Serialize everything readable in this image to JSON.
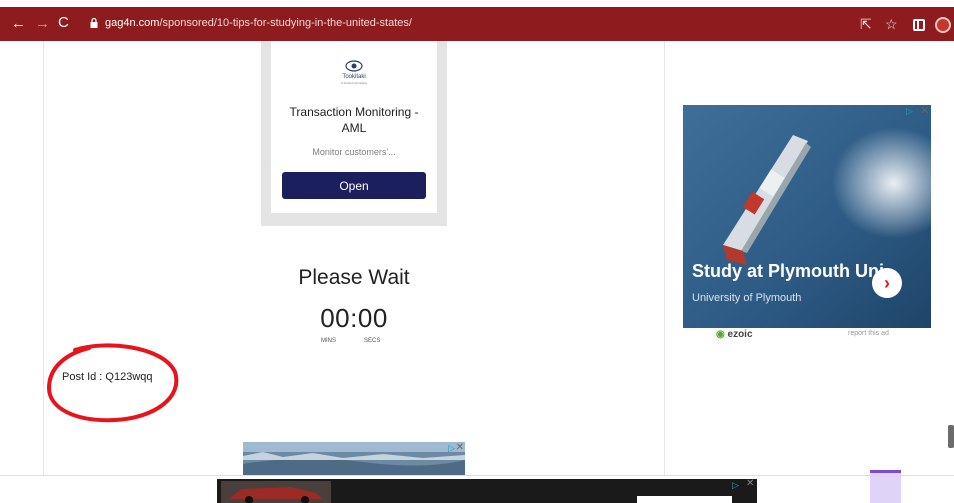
{
  "browser": {
    "url_host": "gag4n.com",
    "url_path": "/sponsored/10-tips-for-studying-in-the-united-states/",
    "back_icon": "←",
    "forward_icon": "→",
    "reload_icon": "C",
    "share_icon": "⇱",
    "star_icon": "☆",
    "toolbar_color": "#8e1c1e"
  },
  "top_ad": {
    "brand": "Tookitaki",
    "brand_sub": "A Fintech Company",
    "title": "Transaction Monitoring - AML",
    "description": "Monitor customers'...",
    "cta": "Open",
    "cta_color": "#1c1f5e"
  },
  "wait": {
    "title": "Please Wait",
    "minutes": "00",
    "separator": ":",
    "seconds": "00",
    "mins_label": "MINS",
    "secs_label": "SECS"
  },
  "post": {
    "label": "Post Id : Q123wqq",
    "highlight_color": "#e8141c"
  },
  "right_ad": {
    "title": "Study at Plymouth Uni",
    "subtitle": "University of Plymouth",
    "arrow": "›",
    "adchoices": "▷",
    "close": "✕"
  },
  "ezoic": {
    "brand": "ezoic",
    "report": "report this ad"
  },
  "bottom_ads": {
    "adchoices": "▷",
    "close": "✕"
  }
}
